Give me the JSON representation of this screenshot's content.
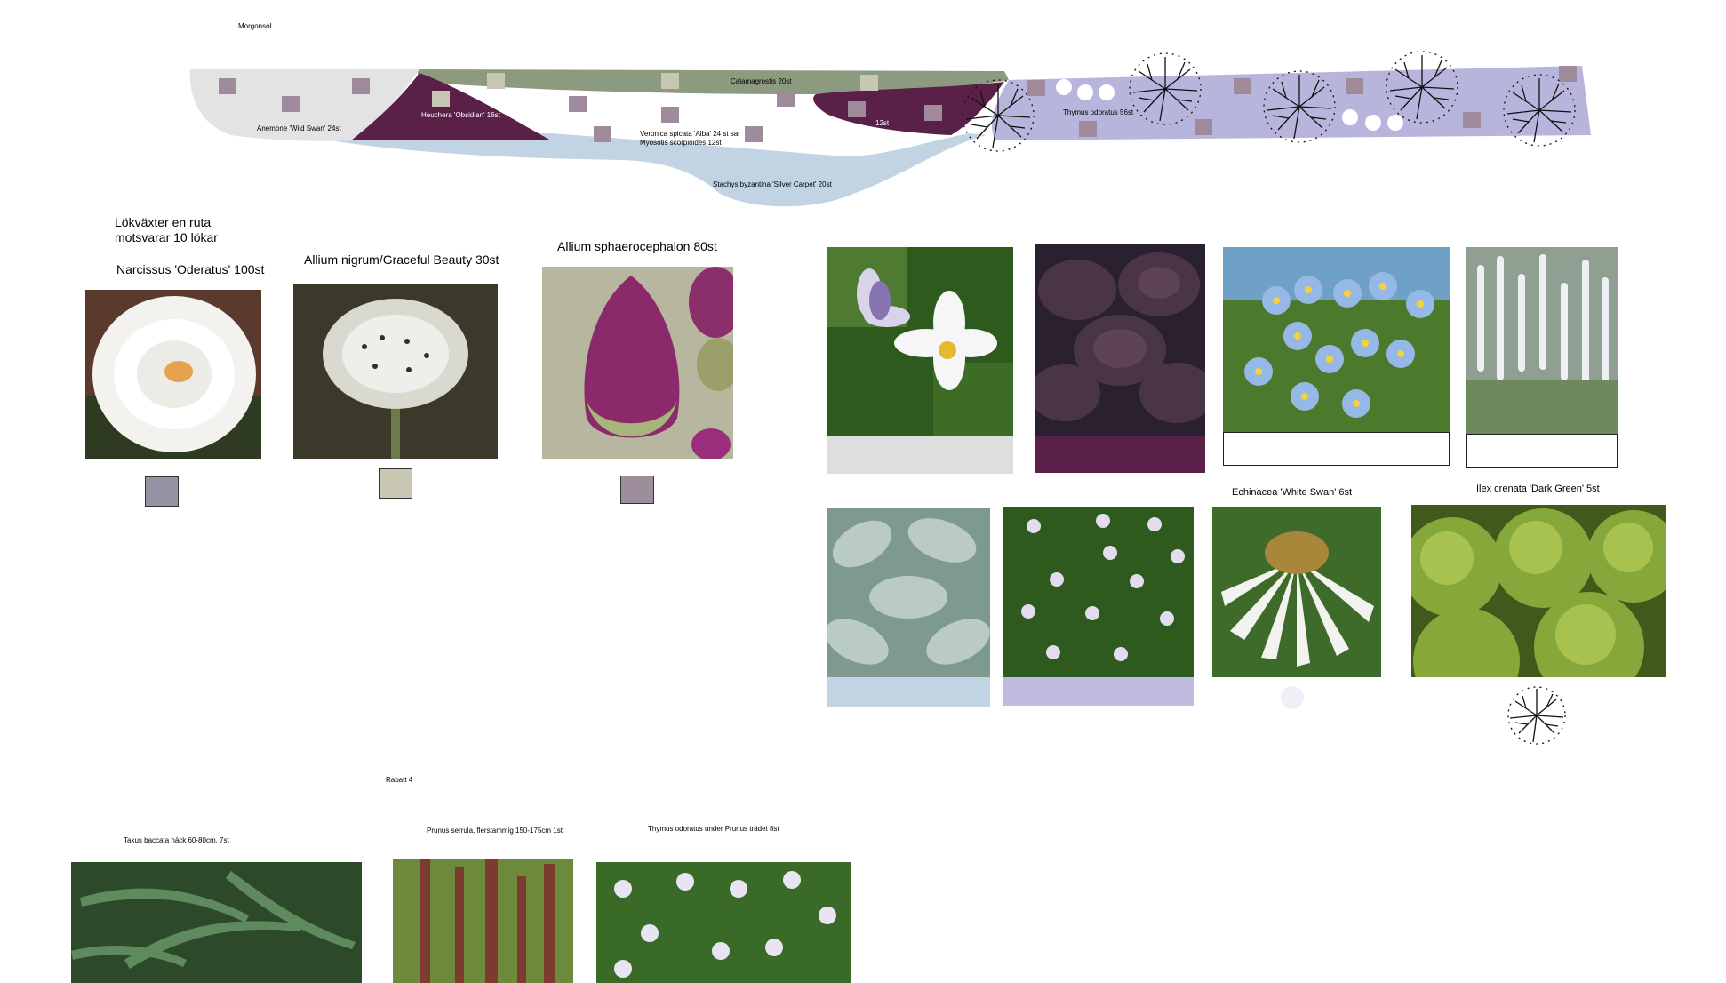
{
  "plan": {
    "morning_sun_label": "Morgonsol",
    "labels": {
      "anemone": "Anemone 'Wild Swan' 24st",
      "heuchera": "Heuchera 'Obsidian' 16st",
      "calamagrostis": "Calamagrostis 20st",
      "veronica": "Veronica spicata 'Alba' 24 st sar",
      "myosotis": "Myosotis scorpioides 12st",
      "twelve": "12st",
      "thymus": "Thymus odoratus 56st",
      "stachys": "Stachys byzantina 'Silver Carpet' 20st"
    },
    "colors": {
      "anemone_zone": "#e3e3e3",
      "heuchera_zone": "#5a2048",
      "calamagrostis_zone": "#8c9a80",
      "stachys_zone": "#c2d4e4",
      "thymus_zone": "#b8b5dd",
      "bulb_squares": "#a08b9c",
      "allium_nigrum_squares": "#c8c7b4"
    }
  },
  "bulbs": {
    "note_line1": "Lökväxter en ruta",
    "note_line2": "motsvarar 10 lökar",
    "narcissus": "Narcissus 'Oderatus' 100st",
    "allium_nigrum": "Allium nigrum/Graceful Beauty 30st",
    "allium_sphaero": "Allium sphaerocephalon 80st"
  },
  "perennials": {
    "echinacea": "Echinacea 'White Swan' 6st",
    "ilex": "Ilex crenata 'Dark Green' 5st"
  },
  "rabatt4": {
    "title": "Rabatt 4",
    "taxus": "Taxus baccata häck 60-80cm, 7st",
    "prunus": "Prunus serrula, flerstammig 150-175cm 1st",
    "thymus_under": "Thymus odoratus under Prunus trädet 8st"
  }
}
